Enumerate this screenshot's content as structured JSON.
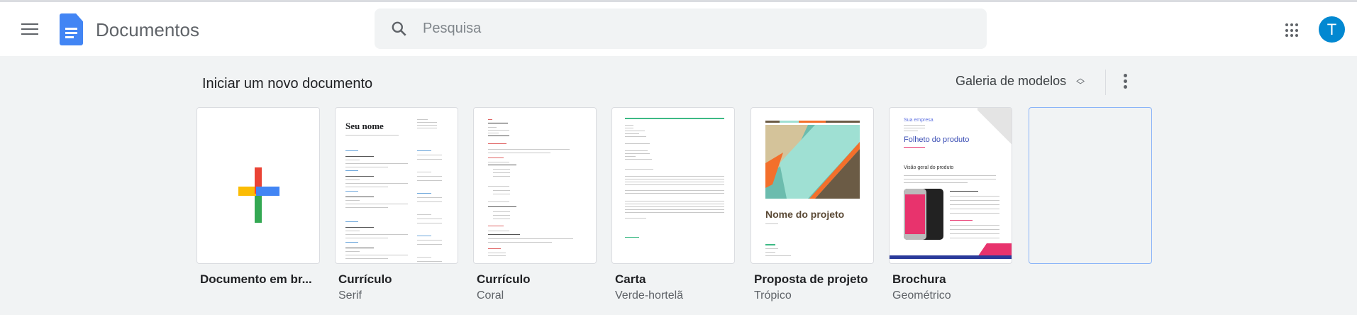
{
  "header": {
    "app_title": "Documentos",
    "search_placeholder": "Pesquisa",
    "avatar_initial": "T",
    "icons": [
      "menu-icon",
      "docs-logo-icon",
      "search-icon",
      "apps-grid-icon"
    ]
  },
  "templates_section": {
    "title": "Iniciar um novo documento",
    "gallery_label": "Galeria de modelos",
    "templates": [
      {
        "title": "Documento em br...",
        "subtitle": ""
      },
      {
        "title": "Currículo",
        "subtitle": "Serif",
        "preview_heading": "Seu nome"
      },
      {
        "title": "Currículo",
        "subtitle": "Coral"
      },
      {
        "title": "Carta",
        "subtitle": "Verde-hortelã"
      },
      {
        "title": "Proposta de projeto",
        "subtitle": "Trópico",
        "preview_heading": "Nome do projeto"
      },
      {
        "title": "Brochura",
        "subtitle": "Geométrico",
        "preview_company": "Sua empresa",
        "preview_heading": "Folheto do produto",
        "preview_subheading": "Visão geral do produto"
      }
    ]
  },
  "colors": {
    "accent": "#4285f4",
    "avatar": "#0288d1",
    "coral": "#e06666",
    "mint": "#3dba85",
    "brochure_pink": "#e8336d",
    "brochure_blue": "#2a3a9a"
  }
}
